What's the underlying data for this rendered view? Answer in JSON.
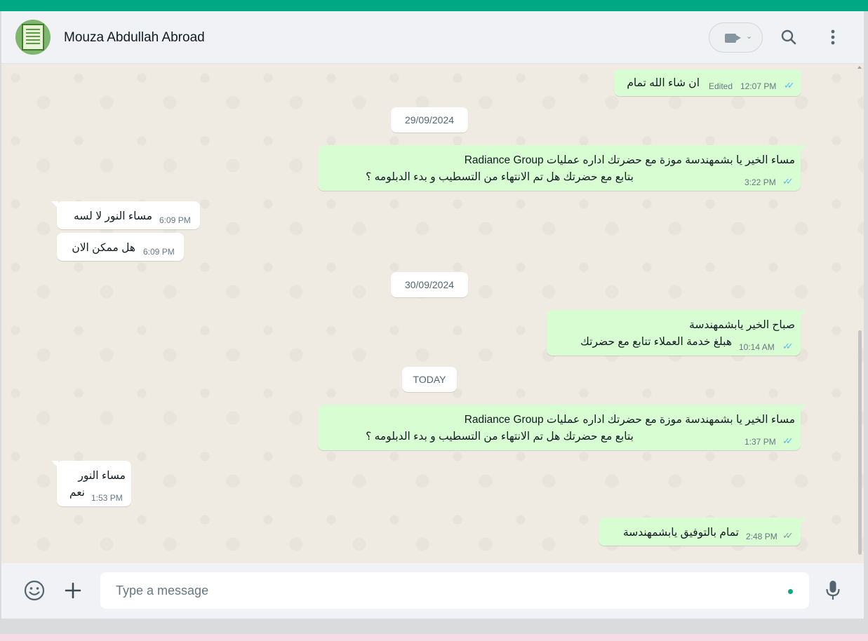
{
  "header": {
    "contact_name": "Mouza Abdullah Abroad"
  },
  "dates": {
    "d1": "29/09/2024",
    "d2": "30/09/2024",
    "d3": "TODAY"
  },
  "messages": {
    "m1": {
      "text": "ان شاء الله تمام",
      "edited": "Edited",
      "time": "12:07 PM"
    },
    "m2": {
      "line1": "مساء الخير يا بشمهندسة موزة مع  حضرتك اداره عمليات Radiance Group",
      "line2": "بتابع مع حضرتك هل تم الانتهاء من التسطيب و بدء الدبلومه ؟",
      "time": "3:22 PM"
    },
    "m3": {
      "text": "مساء النور لا لسه",
      "time": "6:09 PM"
    },
    "m4": {
      "text": "هل ممكن الان",
      "time": "6:09 PM"
    },
    "m5": {
      "line1": "صباح الخير يابشمهندسة",
      "line2": "هبلغ خدمة العملاء تتابع مع حضرتك",
      "time": "10:14 AM"
    },
    "m6": {
      "line1": "مساء الخير يا بشمهندسة موزة مع  حضرتك اداره عمليات Radiance Group",
      "line2": "بتابع مع حضرتك هل تم الانتهاء من التسطيب و بدء الدبلومه ؟",
      "time": "1:37 PM"
    },
    "m7": {
      "line1": "مساء النور",
      "line2": "نعم",
      "time": "1:53 PM"
    },
    "m8": {
      "text": "تمام بالتوفيق يابشمهندسة",
      "time": "2:48 PM"
    }
  },
  "composer": {
    "placeholder": "Type a message"
  },
  "colors": {
    "accent": "#00a884",
    "outgoing_bubble": "#d9fdd3",
    "incoming_bubble": "#ffffff",
    "read_tick": "#53bdeb"
  },
  "icons": [
    "contact-avatar",
    "video-camera-icon",
    "chevron-down-icon",
    "search-icon",
    "menu-dots-icon",
    "emoji-icon",
    "plus-icon",
    "microphone-icon",
    "double-check-icon"
  ]
}
